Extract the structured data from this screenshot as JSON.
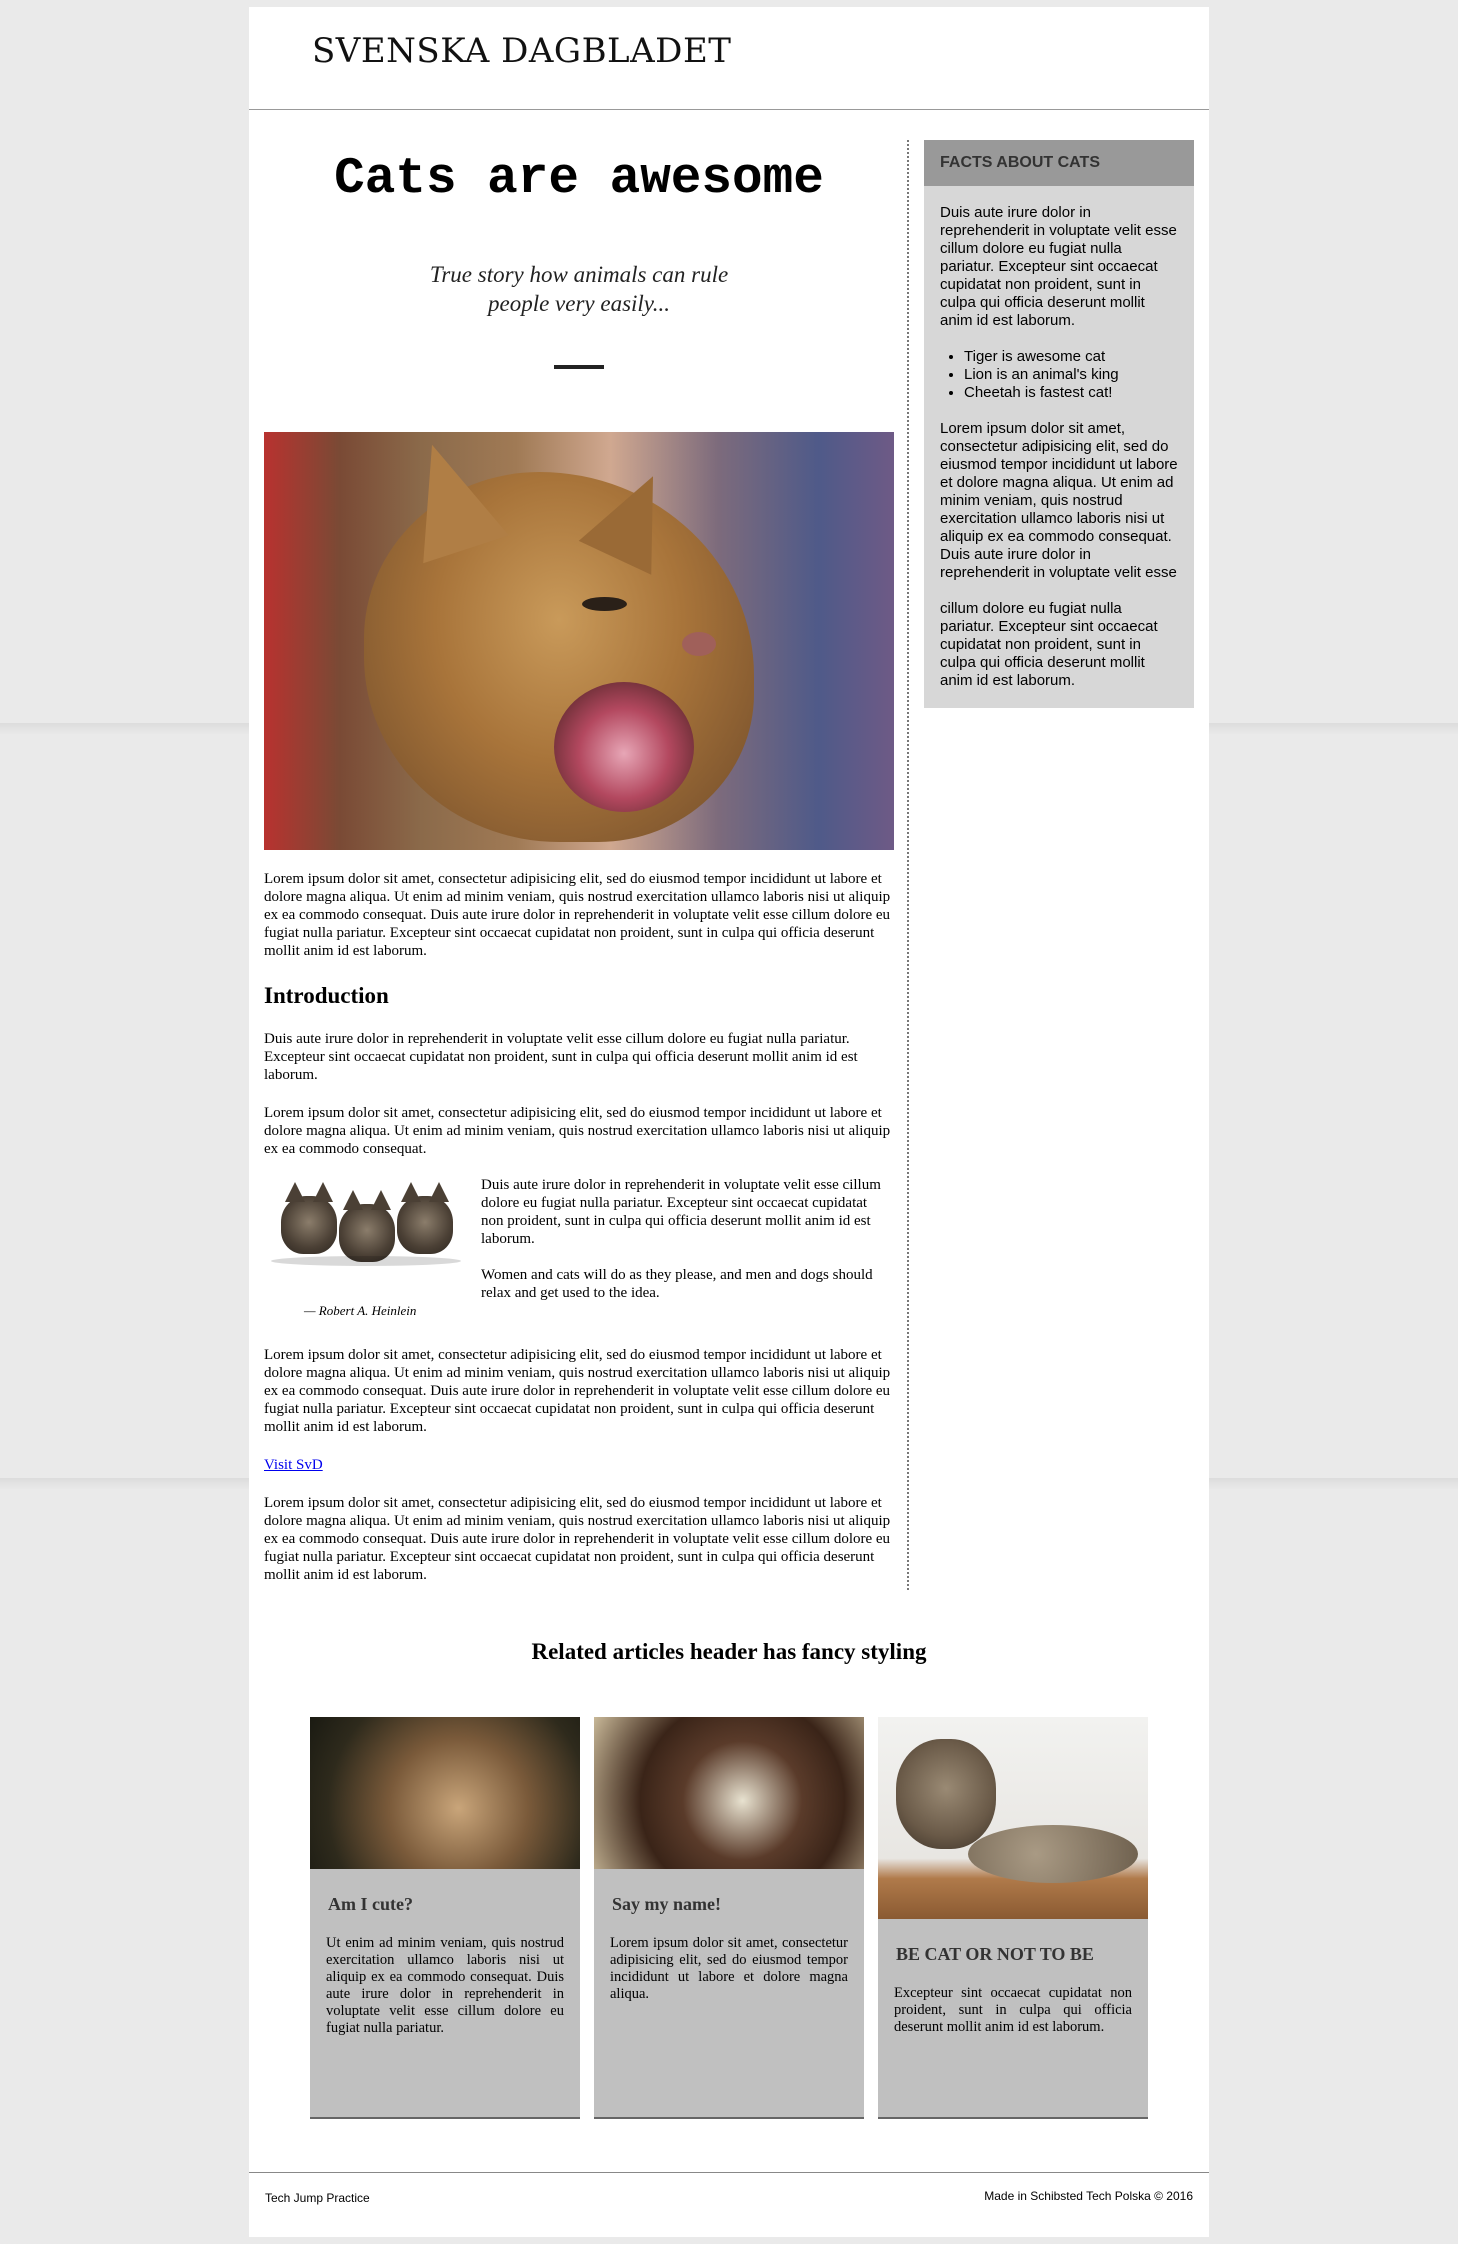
{
  "header": {
    "brand": "SVENSKA DAGBLADET"
  },
  "article": {
    "title": "Cats are awesome",
    "subtitle": "True story how animals can rule people very easily...",
    "para1": "Lorem ipsum dolor sit amet, consectetur adipisicing elit, sed do eiusmod tempor incididunt ut labore et dolore magna aliqua. Ut enim ad minim veniam, quis nostrud exercitation ullamco laboris nisi ut aliquip ex ea commodo consequat. Duis aute irure dolor in reprehenderit in voluptate velit esse cillum dolore eu fugiat nulla pariatur. Excepteur sint occaecat cupidatat non proident, sunt in culpa qui officia deserunt mollit anim id est laborum.",
    "intro_heading": "Introduction",
    "para2": "Duis aute irure dolor in reprehenderit in voluptate velit esse cillum dolore eu fugiat nulla pariatur. Excepteur sint occaecat cupidatat non proident, sunt in culpa qui officia deserunt mollit anim id est laborum.",
    "para3": "Lorem ipsum dolor sit amet, consectetur adipisicing elit, sed do eiusmod tempor incididunt ut labore et dolore magna aliqua. Ut enim ad minim veniam, quis nostrud exercitation ullamco laboris nisi ut aliquip ex ea commodo consequat.",
    "quote_para": "Duis aute irure dolor in reprehenderit in voluptate velit esse cillum dolore eu fugiat nulla pariatur. Excepteur sint occaecat cupidatat non proident, sunt in culpa qui officia deserunt mollit anim id est laborum.",
    "quote": "Women and cats will do as they please, and men and dogs should relax and get used to the idea.",
    "quote_author": "— Robert A. Heinlein",
    "para4": "Lorem ipsum dolor sit amet, consectetur adipisicing elit, sed do eiusmod tempor incididunt ut labore et dolore magna aliqua. Ut enim ad minim veniam, quis nostrud exercitation ullamco laboris nisi ut aliquip ex ea commodo consequat. Duis aute irure dolor in reprehenderit in voluptate velit esse cillum dolore eu fugiat nulla pariatur. Excepteur sint occaecat cupidatat non proident, sunt in culpa qui officia deserunt mollit anim id est laborum.",
    "link_label": "Visit SvD",
    "para5": "Lorem ipsum dolor sit amet, consectetur adipisicing elit, sed do eiusmod tempor incididunt ut labore et dolore magna aliqua. Ut enim ad minim veniam, quis nostrud exercitation ullamco laboris nisi ut aliquip ex ea commodo consequat. Duis aute irure dolor in reprehenderit in voluptate velit esse cillum dolore eu fugiat nulla pariatur. Excepteur sint occaecat cupidatat non proident, sunt in culpa qui officia deserunt mollit anim id est laborum."
  },
  "aside": {
    "heading": "FACTS ABOUT CATS",
    "p1": "Duis aute irure dolor in reprehenderit in voluptate velit esse cillum dolore eu fugiat nulla pariatur. Excepteur sint occaecat cupidatat non proident, sunt in culpa qui officia deserunt mollit anim id est laborum.",
    "list": [
      "Tiger is awesome cat",
      "Lion is an animal's king",
      "Cheetah is fastest cat!"
    ],
    "p2": "Lorem ipsum dolor sit amet, consectetur adipisicing elit, sed do eiusmod tempor incididunt ut labore et dolore magna aliqua. Ut enim ad minim veniam, quis nostrud exercitation ullamco laboris nisi ut aliquip ex ea commodo consequat. Duis aute irure dolor in reprehenderit in voluptate velit esse",
    "p3": "cillum dolore eu fugiat nulla pariatur. Excepteur sint occaecat cupidatat non proident, sunt in culpa qui officia deserunt mollit anim id est laborum."
  },
  "related": {
    "title": "Related articles header has fancy styling",
    "cards": [
      {
        "title": "Am I cute?",
        "text": "Ut enim ad minim veniam, quis nostrud exercitation ullamco laboris nisi ut aliquip ex ea commodo consequat. Duis aute irure dolor in reprehenderit in voluptate velit esse cillum dolore eu fugiat nulla pariatur."
      },
      {
        "title": "Say my name!",
        "text": "Lorem ipsum dolor sit amet, consectetur adipisicing elit, sed do eiusmod tempor incididunt ut labore et dolore magna aliqua."
      },
      {
        "title": "BE CAT OR NOT TO BE",
        "text": "Excepteur sint occaecat cupidatat non proident, sunt in culpa qui officia deserunt mollit anim id est laborum."
      }
    ]
  },
  "footer": {
    "left": "Tech Jump Practice",
    "right": "Made in Schibsted Tech Polska © 2016"
  }
}
